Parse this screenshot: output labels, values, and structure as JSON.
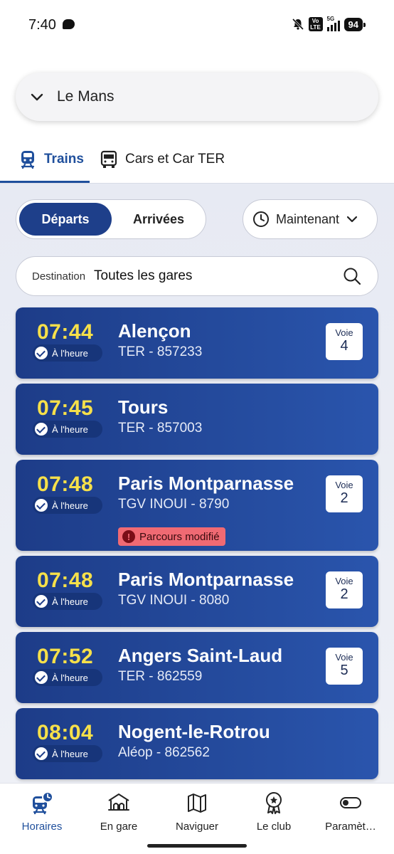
{
  "status_bar": {
    "time": "7:40",
    "volte": "Vo LTE",
    "network": "5G",
    "signal_bars": 4,
    "battery": "94"
  },
  "station": {
    "name": "Le Mans",
    "icon": "chevron-down-icon"
  },
  "modes": {
    "tabs": [
      {
        "label": "Trains",
        "icon": "train-icon",
        "active": true
      },
      {
        "label": "Cars et Car TER",
        "icon": "bus-icon",
        "active": false
      }
    ]
  },
  "direction": {
    "departures_label": "Départs",
    "arrivals_label": "Arrivées",
    "selected": "Départs"
  },
  "time_filter": {
    "label": "Maintenant"
  },
  "destination_filter": {
    "label": "Destination",
    "value": "Toutes les gares"
  },
  "departures": [
    {
      "time": "07:44",
      "status": "À l'heure",
      "destination": "Alençon",
      "train": "TER - 857233",
      "voie_label": "Voie",
      "voie": "4",
      "alert": ""
    },
    {
      "time": "07:45",
      "status": "À l'heure",
      "destination": "Tours",
      "train": "TER - 857003",
      "voie_label": "",
      "voie": "",
      "alert": ""
    },
    {
      "time": "07:48",
      "status": "À l'heure",
      "destination": "Paris Montparnasse",
      "train": "TGV INOUI - 8790",
      "voie_label": "Voie",
      "voie": "2",
      "alert": "Parcours modifié"
    },
    {
      "time": "07:48",
      "status": "À l'heure",
      "destination": "Paris Montparnasse",
      "train": "TGV INOUI - 8080",
      "voie_label": "Voie",
      "voie": "2",
      "alert": ""
    },
    {
      "time": "07:52",
      "status": "À l'heure",
      "destination": "Angers Saint-Laud",
      "train": "TER - 862559",
      "voie_label": "Voie",
      "voie": "5",
      "alert": ""
    },
    {
      "time": "08:04",
      "status": "À l'heure",
      "destination": "Nogent-le-Rotrou",
      "train": "Aléop - 862562",
      "voie_label": "",
      "voie": "",
      "alert": ""
    }
  ],
  "bottom_nav": {
    "items": [
      {
        "label": "Horaires",
        "icon": "schedule-train-icon",
        "active": true
      },
      {
        "label": "En gare",
        "icon": "station-icon",
        "active": false
      },
      {
        "label": "Naviguer",
        "icon": "map-icon",
        "active": false
      },
      {
        "label": "Le club",
        "icon": "badge-icon",
        "active": false
      },
      {
        "label": "Paramèt…",
        "icon": "toggle-icon",
        "active": false
      }
    ]
  },
  "colors": {
    "brand_blue": "#1e3f8a",
    "accent_blue": "#1f4f9c",
    "time_yellow": "#f6e04a",
    "alert_red": "#f06a73"
  }
}
